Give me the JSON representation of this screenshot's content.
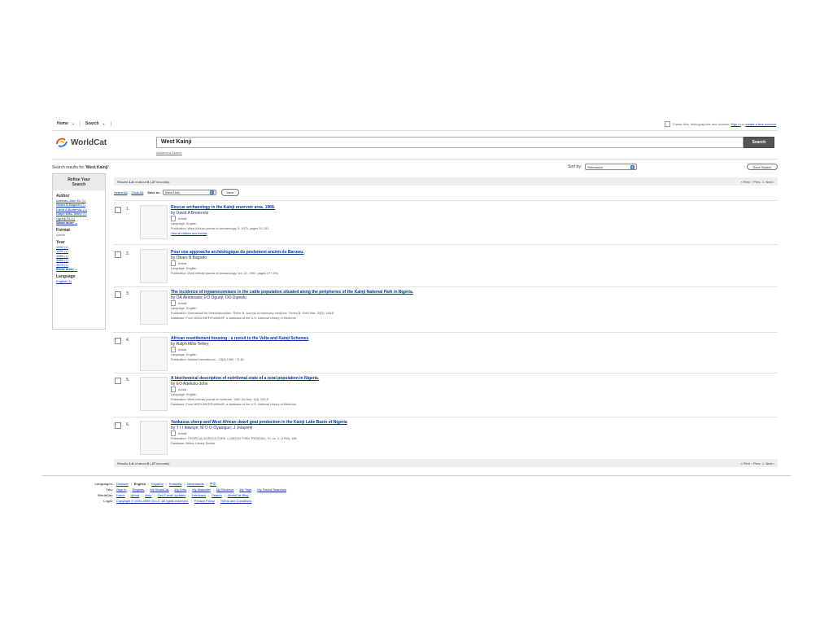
{
  "breadcrumb": [
    {
      "label": "Home"
    },
    {
      "label": "Search"
    }
  ],
  "topright": {
    "checkbox_text": "Create lists, bibliographies and reviews:",
    "signin": "Sign in",
    "or": "or",
    "create_account": "create a free account"
  },
  "brand": {
    "name": "WorldCat"
  },
  "search": {
    "query": "West Kainji",
    "button": "Search",
    "advanced": "Advanced Search"
  },
  "results_for": {
    "prefix": "Search results for ",
    "query": "'West Kainji'"
  },
  "sort": {
    "label": "Sort by:",
    "value": "Relevance"
  },
  "save_search": "Save Search",
  "sidebar": {
    "refine_title": "Refine Your Search",
    "author": {
      "title": "Author",
      "items": [
        {
          "name": "Adekolu-John Eo",
          "count": "(1)"
        },
        {
          "name": "Obaro B Bagodo",
          "count": "(1)"
        },
        {
          "name": "David A Breternitz",
          "count": "(1)"
        },
        {
          "name": "Ralph Mills-Tettey",
          "count": "(1)"
        },
        {
          "name": "Ogunji Fo",
          "count": "(1)"
        }
      ],
      "more": "Show more ..."
    },
    "format": {
      "title": "Format",
      "value": "Article"
    },
    "year": {
      "title": "Year",
      "items": [
        {
          "name": "1992",
          "count": "(1)"
        },
        {
          "name": "1990",
          "count": "(1)"
        },
        {
          "name": "1989",
          "count": "(1)"
        },
        {
          "name": "1983",
          "count": "(1)"
        },
        {
          "name": "1975",
          "count": "(1)"
        }
      ],
      "more": "Show more ..."
    },
    "language": {
      "title": "Language",
      "items": [
        {
          "name": "English",
          "count": "(6)"
        }
      ]
    }
  },
  "pager": {
    "prefix": "Results ",
    "range": "1-6",
    "mid": " of about ",
    "total": "6",
    "time_open": " (",
    "time": ".27",
    "time_close": " seconds)",
    "first": "« First",
    "prev": "‹ Prev",
    "page": "1",
    "next": "Next ›"
  },
  "actions": {
    "select_all": "Select All",
    "clear_all": "Clear All",
    "save_to": "Save to:",
    "list": "[New List]",
    "save": "Save"
  },
  "results": [
    {
      "num": "1.",
      "title": "Rescue archaeology in the Kainji reservoir area, 1968.",
      "author": "by David A Breternitz",
      "type": "Article",
      "language": "Language: English",
      "publication": "Publication: West African journal of archaeology, 5, 1975, pages 91-151.",
      "extra": "",
      "editions": "View all editions and formats"
    },
    {
      "num": "2.",
      "title": "Pour une approache archéologique du peulement ancien du Baruwu.",
      "author": "by Obaro B Bagodo",
      "type": "Article",
      "language": "Language: English",
      "publication": "Publication: West African journal of archaeology, Vol. 22, 1992, pages 277-294.",
      "extra": "",
      "editions": ""
    },
    {
      "num": "3.",
      "title": "The incidence of trypanosomiasis in the cattle population situated along the peripheries of the Kainji National Park in Nigeria.",
      "author": "by OA Akinboade; FO Ogunji; OO Dipeolu",
      "type": "Article",
      "language": "Language: English",
      "publication": "Publication: Zentralblatt für Veterinärmedizin. Reihe B. Journal of veterinary medicine. Series B, 1983 Mar; 30(3): 145-8",
      "extra": "Database: From MEDLINE®/PubMed®, a database of the U.S. National Library of Medicine.",
      "editions": ""
    },
    {
      "num": "4.",
      "title": "African resettlement housing : a revisit to the Volta and Kainji Schemes",
      "author": "by Ralph Mills-Tettey;",
      "type": "Article",
      "language": "Language: English",
      "publication": "Publication: Habitat international. - 13(4) 1989 : 71-81",
      "extra": "",
      "editions": ""
    },
    {
      "num": "5.",
      "title": "A biochemical description of nutritional state of a rural population in Nigeria.",
      "author": "by EO Adekolu-John",
      "type": "Article",
      "language": "Language: English",
      "publication": "Publication: West African journal of medicine, 1990 Jul-Sep; 9(3): 220-5",
      "extra": "Database: From MEDLINE®/PubMed®, a database of the U.S. National Library of Medicine.",
      "editions": ""
    },
    {
      "num": "6.",
      "title": "Yankassa sheep and West African dwarf goat production in the Kainji Lake Basin of Nigeria",
      "author": "by T I I Ibiwoye; M O O Oyatogun; J Jolayemi",
      "type": "Article",
      "language": "",
      "publication": "Publication: TROPICAL AGRICULTURE -LONDON THEN TRINIDAD- 70, no. 2, (1993): 165",
      "extra": "Database: British Library Serials",
      "editions": ""
    }
  ],
  "footer": {
    "languages": {
      "label": "Languages:",
      "items": [
        "Deutsch",
        "English",
        "Español",
        "Français",
        "Nederlands",
        "中文"
      ],
      "current": "English"
    },
    "you": {
      "label": "You:",
      "items": [
        "Sign In",
        "Register",
        "My WorldCat",
        "My Lists",
        "My Watchlist",
        "My Reviews",
        "My Tags",
        "My Saved Searches"
      ]
    },
    "worldcat": {
      "label": "WorldCat:",
      "items": [
        "Home",
        "About",
        "Help",
        "Get E-mail Updates",
        "Feedback",
        "Search",
        "WorldCat Blog"
      ]
    },
    "legal": {
      "label": "Legal:",
      "items": [
        "Copyright © 2001-2009 OCLC. All rights reserved.",
        "Privacy Policy",
        "Terms and Conditions"
      ]
    }
  }
}
